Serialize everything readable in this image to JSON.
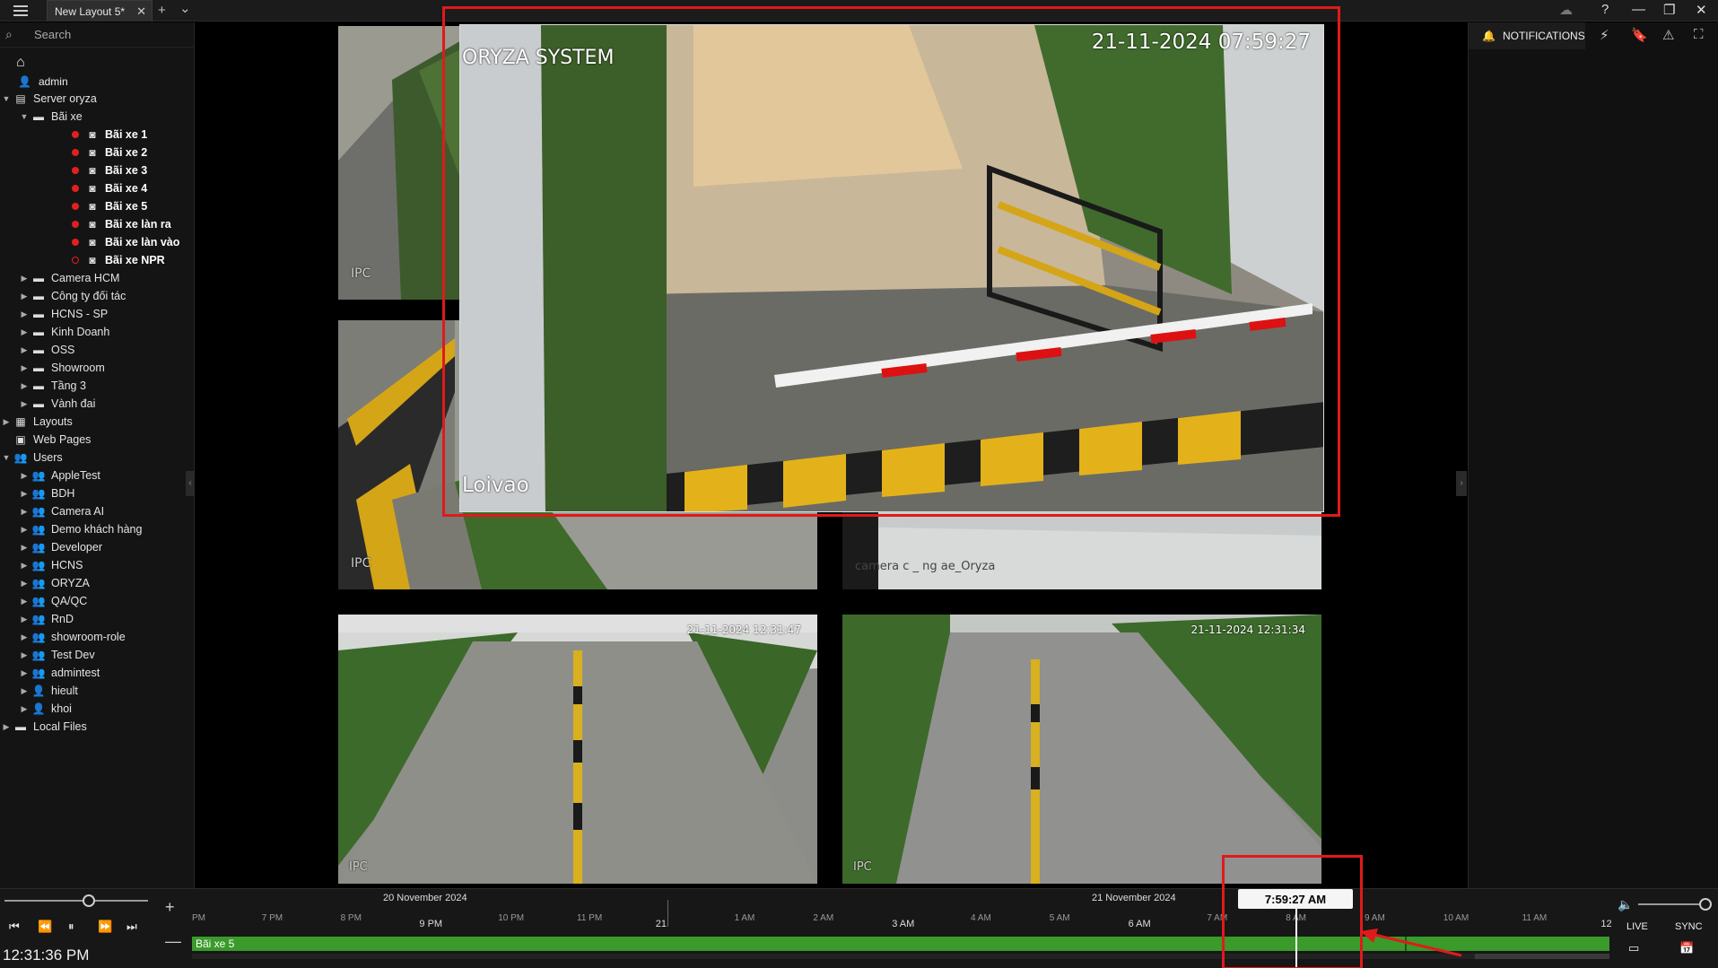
{
  "app": {
    "tab_title": "New Layout 5*",
    "tab_close": "✕",
    "tab_add": "+",
    "tab_dropdown": "⌄"
  },
  "window_controls": {
    "cloud": "☁",
    "help": "?",
    "minimize": "—",
    "restore": "❐",
    "close": "✕"
  },
  "sidebar": {
    "search_placeholder": "Search",
    "home_icon": "⌂",
    "user": "admin",
    "tree": [
      {
        "label": "Server oryza",
        "indent": 0,
        "arrow": "▼",
        "icon": "▤",
        "kind": "server"
      },
      {
        "label": "Bãi xe",
        "indent": 1,
        "arrow": "▼",
        "icon": "▬",
        "kind": "folder"
      },
      {
        "label": "Bãi xe 1",
        "indent": 2,
        "kind": "cam",
        "rec": true
      },
      {
        "label": "Bãi xe 2",
        "indent": 2,
        "kind": "cam",
        "rec": true
      },
      {
        "label": "Bãi xe 3",
        "indent": 2,
        "kind": "cam",
        "rec": true
      },
      {
        "label": "Bãi xe 4",
        "indent": 2,
        "kind": "cam",
        "rec": true
      },
      {
        "label": "Bãi xe 5",
        "indent": 2,
        "kind": "cam",
        "rec": true
      },
      {
        "label": "Bãi xe làn ra",
        "indent": 2,
        "kind": "cam",
        "rec": true
      },
      {
        "label": "Bãi xe làn vào",
        "indent": 2,
        "kind": "cam",
        "rec": true
      },
      {
        "label": "Bãi xe NPR",
        "indent": 2,
        "kind": "cam",
        "rec": false
      },
      {
        "label": "Camera HCM",
        "indent": 1,
        "arrow": "▶",
        "icon": "▬",
        "kind": "folder"
      },
      {
        "label": "Công ty đối tác",
        "indent": 1,
        "arrow": "▶",
        "icon": "▬",
        "kind": "folder"
      },
      {
        "label": "HCNS - SP",
        "indent": 1,
        "arrow": "▶",
        "icon": "▬",
        "kind": "folder"
      },
      {
        "label": "Kinh Doanh",
        "indent": 1,
        "arrow": "▶",
        "icon": "▬",
        "kind": "folder"
      },
      {
        "label": "OSS",
        "indent": 1,
        "arrow": "▶",
        "icon": "▬",
        "kind": "folder"
      },
      {
        "label": "Showroom",
        "indent": 1,
        "arrow": "▶",
        "icon": "▬",
        "kind": "folder"
      },
      {
        "label": "Tầng 3",
        "indent": 1,
        "arrow": "▶",
        "icon": "▬",
        "kind": "folder"
      },
      {
        "label": "Vành đai",
        "indent": 1,
        "arrow": "▶",
        "icon": "▬",
        "kind": "folder"
      },
      {
        "label": "Layouts",
        "indent": 0,
        "arrow": "▶",
        "icon": "▦",
        "kind": "section"
      },
      {
        "label": "Web Pages",
        "indent": 0,
        "arrow": "",
        "icon": "▣",
        "kind": "section"
      },
      {
        "label": "Users",
        "indent": 0,
        "arrow": "▼",
        "icon": "👥",
        "kind": "section"
      },
      {
        "label": "AppleTest",
        "indent": 1,
        "arrow": "▶",
        "icon": "👥",
        "kind": "usergroup"
      },
      {
        "label": "BDH",
        "indent": 1,
        "arrow": "▶",
        "icon": "👥",
        "kind": "usergroup"
      },
      {
        "label": "Camera AI",
        "indent": 1,
        "arrow": "▶",
        "icon": "👥",
        "kind": "usergroup"
      },
      {
        "label": "Demo khách hàng",
        "indent": 1,
        "arrow": "▶",
        "icon": "👥",
        "kind": "usergroup"
      },
      {
        "label": "Developer",
        "indent": 1,
        "arrow": "▶",
        "icon": "👥",
        "kind": "usergroup"
      },
      {
        "label": "HCNS",
        "indent": 1,
        "arrow": "▶",
        "icon": "👥",
        "kind": "usergroup"
      },
      {
        "label": "ORYZA",
        "indent": 1,
        "arrow": "▶",
        "icon": "👥",
        "kind": "usergroup"
      },
      {
        "label": "QA/QC",
        "indent": 1,
        "arrow": "▶",
        "icon": "👥",
        "kind": "usergroup"
      },
      {
        "label": "RnD",
        "indent": 1,
        "arrow": "▶",
        "icon": "👥",
        "kind": "usergroup"
      },
      {
        "label": "showroom-role",
        "indent": 1,
        "arrow": "▶",
        "icon": "👥",
        "kind": "usergroup"
      },
      {
        "label": "Test Dev",
        "indent": 1,
        "arrow": "▶",
        "icon": "👥",
        "kind": "usergroup"
      },
      {
        "label": "admintest",
        "indent": 1,
        "arrow": "▶",
        "icon": "👥",
        "kind": "usergroup"
      },
      {
        "label": "hieult",
        "indent": 1,
        "arrow": "▶",
        "icon": "👤",
        "kind": "user"
      },
      {
        "label": "khoi",
        "indent": 1,
        "arrow": "▶",
        "icon": "👤",
        "kind": "user"
      },
      {
        "label": "Local Files",
        "indent": 0,
        "arrow": "▶",
        "icon": "▬",
        "kind": "section"
      }
    ]
  },
  "cameras": {
    "main": {
      "title": "ORYZA SYSTEM",
      "timestamp": "21-11-2024 07:59:27",
      "name": "Loivao"
    },
    "top_left": {
      "label": "IPC"
    },
    "mid_left": {
      "label": "IPC"
    },
    "mid_right": {
      "label": "camera c _ ng ae_Oryza"
    },
    "bottom_left": {
      "label": "IPC",
      "timestamp": "21-11-2024 12:31:47"
    },
    "bottom_right": {
      "label": "IPC",
      "timestamp": "21-11-2024 12:31:34"
    }
  },
  "right_panel": {
    "notifications_label": "NOTIFICATIONS"
  },
  "timeline": {
    "clock": "12:31:36 PM",
    "cursor_time": "7:59:27 AM",
    "track_label": "Bãi xe 5",
    "dates": [
      "20 November 2024",
      "21 November 2024"
    ],
    "hours": [
      "PM",
      "7 PM",
      "8 PM",
      "9 PM",
      "10 PM",
      "11 PM",
      "21",
      "1 AM",
      "2 AM",
      "3 AM",
      "4 AM",
      "5 AM",
      "6 AM",
      "7 AM",
      "8 AM",
      "9 AM",
      "10 AM",
      "11 AM",
      "12"
    ],
    "live": "LIVE",
    "sync": "SYNC",
    "zoom_in": "+",
    "zoom_out": "—"
  }
}
